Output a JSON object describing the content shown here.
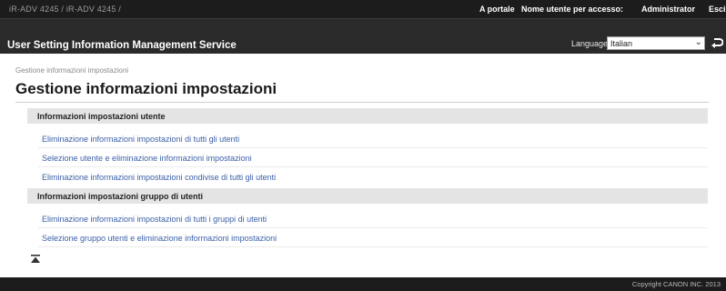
{
  "topbar": {
    "device_name": "iR-ADV 4245 / iR-ADV 4245 /",
    "portal_link": "A portale",
    "user_label": "Nome utente per accesso:",
    "user_name": "Administrator",
    "logout": "Esci"
  },
  "header": {
    "app_title": "User Setting Information Management Service",
    "language_label": "Language:",
    "language_value": "Italian"
  },
  "breadcrumb": "Gestione informazioni impostazioni",
  "page_title": "Gestione informazioni impostazioni",
  "sections": [
    {
      "title": "Informazioni impostazioni utente",
      "links": [
        "Eliminazione informazioni impostazioni di tutti gli utenti",
        "Selezione utente e eliminazione informazioni impostazioni",
        "Eliminazione informazioni impostazioni condivise di tutti gli utenti"
      ]
    },
    {
      "title": "Informazioni impostazioni gruppo di utenti",
      "links": [
        "Eliminazione informazioni impostazioni di tutti i gruppi di utenti",
        "Selezione gruppo utenti e eliminazione informazioni impostazioni"
      ]
    }
  ],
  "icons": {
    "apply_language": "return-arrow-icon",
    "back_to_top": "back-to-top-icon"
  },
  "footer": {
    "copyright": "Copyright CANON INC. 2013"
  }
}
